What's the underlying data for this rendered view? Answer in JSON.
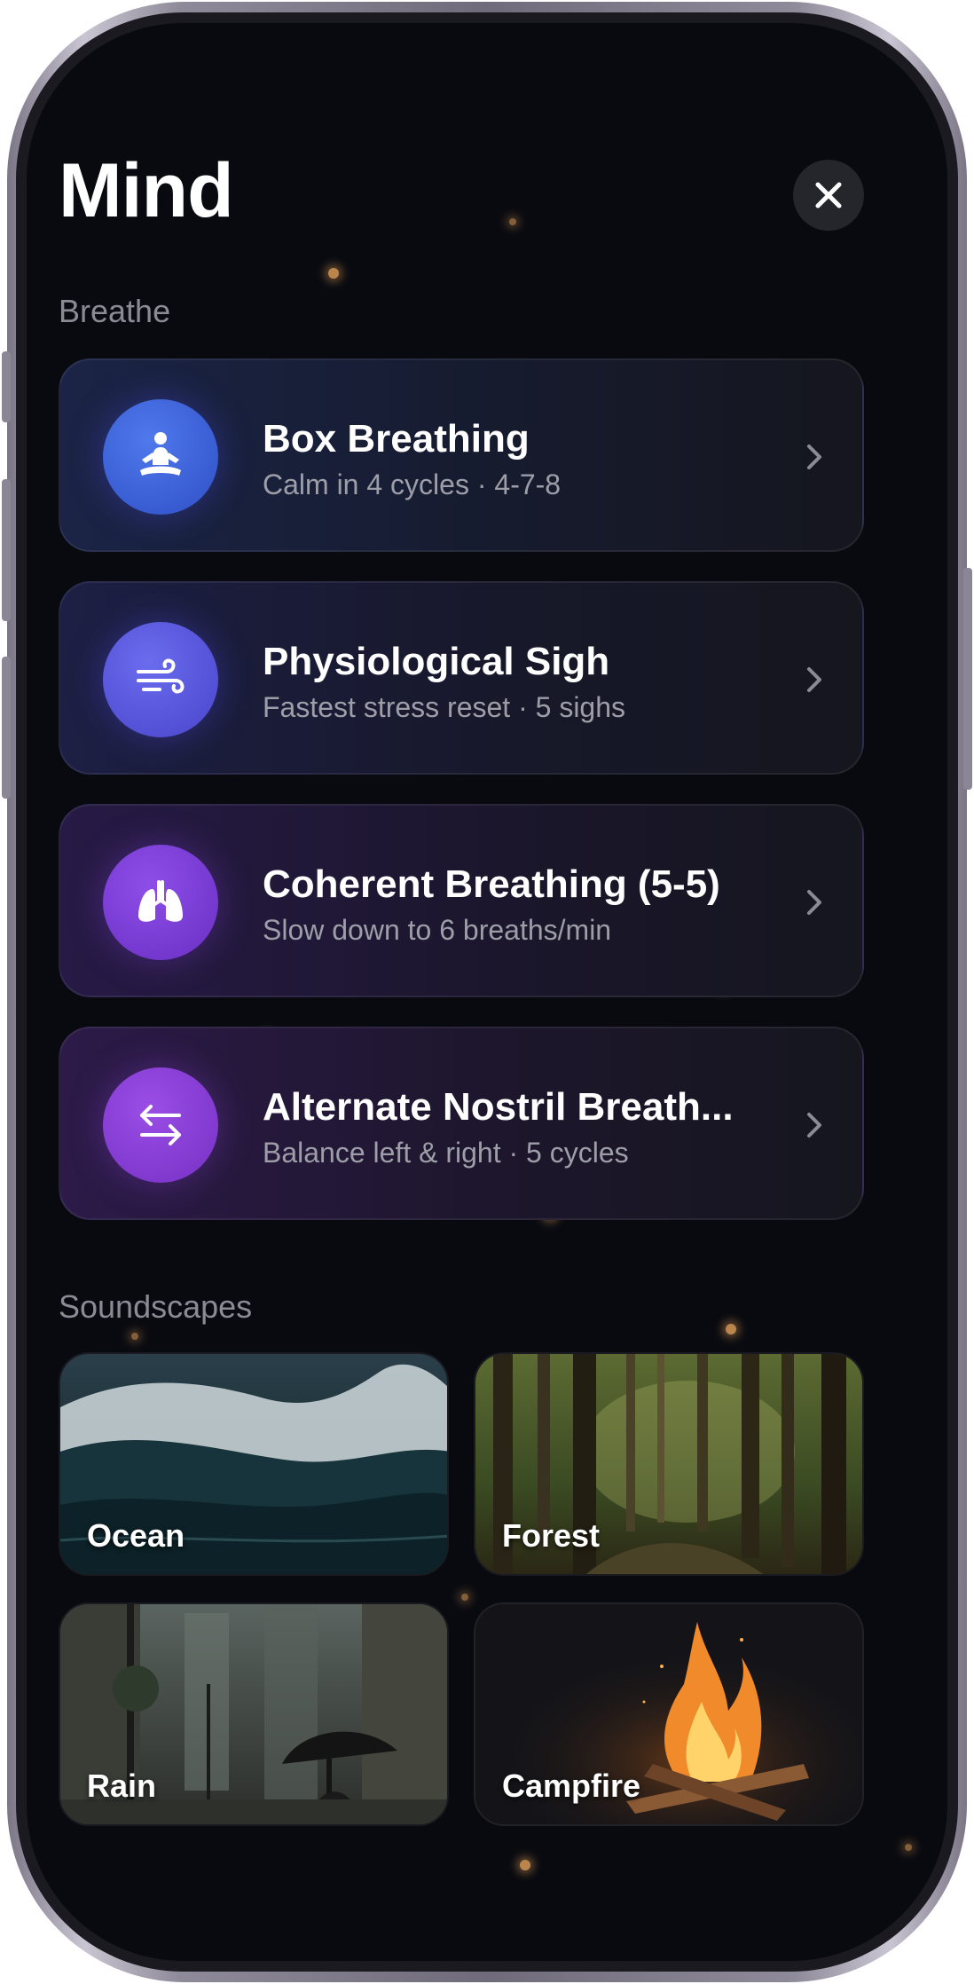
{
  "header": {
    "title": "Mind",
    "close_icon": "close-icon"
  },
  "breathe": {
    "label": "Breathe",
    "items": [
      {
        "title": "Box Breathing",
        "subtitle": "Calm in 4 cycles · 4-7-8",
        "icon": "meditation-icon",
        "color": "#3f63d8"
      },
      {
        "title": "Physiological Sigh",
        "subtitle": "Fastest stress reset · 5 sighs",
        "icon": "wind-icon",
        "color": "#5a55d8"
      },
      {
        "title": "Coherent Breathing (5-5)",
        "subtitle": "Slow down to 6 breaths/min",
        "icon": "lungs-icon",
        "color": "#7a3fd6"
      },
      {
        "title": "Alternate Nostril Breath...",
        "subtitle": "Balance left & right · 5 cycles",
        "icon": "arrows-swap-icon",
        "color": "#8a3fd0"
      }
    ]
  },
  "soundscapes": {
    "label": "Soundscapes",
    "items": [
      {
        "label": "Ocean"
      },
      {
        "label": "Forest"
      },
      {
        "label": "Rain"
      },
      {
        "label": "Campfire"
      }
    ]
  },
  "colors": {
    "background": "#090a10",
    "particle": "#e7a45b",
    "accent": "#3f63d8"
  }
}
